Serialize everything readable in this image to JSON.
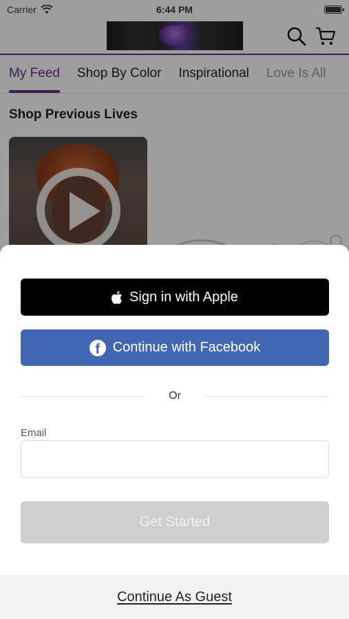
{
  "status_bar": {
    "carrier": "Carrier",
    "time": "6:44 PM"
  },
  "tabs": [
    {
      "label": "My Feed"
    },
    {
      "label": "Shop By Color"
    },
    {
      "label": "Inspirational"
    },
    {
      "label": "Love Is All"
    }
  ],
  "section_title": "Shop Previous Lives",
  "sheet": {
    "apple_label": "Sign in with Apple",
    "facebook_label": "Continue with Facebook",
    "or_text": "Or",
    "email_label": "Email",
    "email_value": "",
    "get_started_label": "Get Started",
    "guest_label": "Continue As Guest"
  },
  "colors": {
    "brand_purple": "#6a2c8c",
    "facebook_blue": "#4267b2",
    "apple_black": "#000000",
    "disabled_gray": "#cfcfcf"
  },
  "icons": [
    "wifi-icon",
    "battery-icon",
    "search-icon",
    "cart-icon",
    "play-icon",
    "apple-icon",
    "facebook-icon"
  ]
}
